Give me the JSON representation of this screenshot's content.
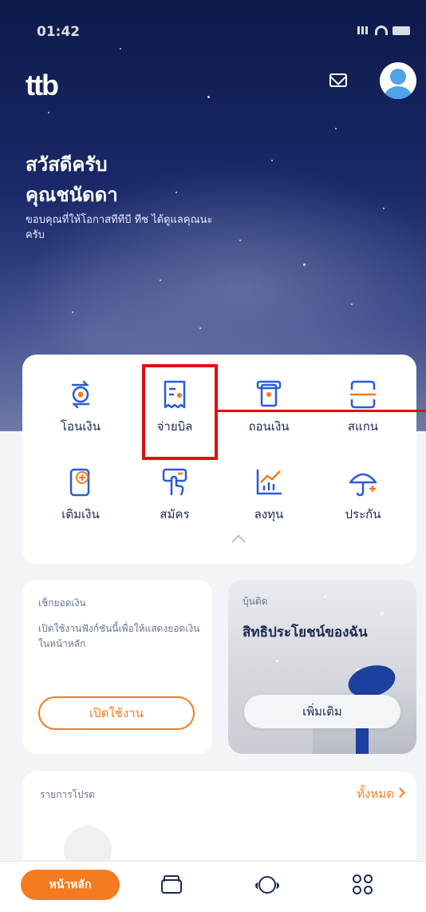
{
  "status_bar": {
    "time": "01:42"
  },
  "header": {
    "logo": "ttb",
    "mail_icon": "mail-icon",
    "avatar_icon": "profile-icon"
  },
  "greeting": {
    "line1": "สวัสดีครับ",
    "line2": "คุณชนัดดา",
    "subtitle": "ขอบคุณที่ให้โอกาสทีทีบี ทีช ได้ดูแลคุณนะครับ"
  },
  "quick_menu": {
    "items": [
      {
        "label": "โอนเงิน",
        "icon": "transfer-icon"
      },
      {
        "label": "จ่ายบิล",
        "icon": "bill-icon"
      },
      {
        "label": "ถอนเงิน",
        "icon": "withdraw-icon"
      },
      {
        "label": "สแกน",
        "icon": "scan-icon"
      },
      {
        "label": "เติมเงิน",
        "icon": "topup-icon"
      },
      {
        "label": "สมัคร",
        "icon": "apply-icon"
      },
      {
        "label": "ลงทุน",
        "icon": "invest-icon"
      },
      {
        "label": "ประกัน",
        "icon": "insurance-icon"
      }
    ]
  },
  "balance_card": {
    "title": "เช็กยอดเงิน",
    "description": "เปิดใช้งานฟังก์ชันนี้เพื่อให้แสดงยอดเงินในหน้าหลัก",
    "button": "เปิดใช้งาน"
  },
  "promo_card": {
    "tag": "บุ้นติด",
    "title": "สิทธิประโยชน์ของฉัน",
    "button": "เพิ่มเติม"
  },
  "favorites": {
    "title": "รายการโปรด",
    "see_all": "ทั้งหมด"
  },
  "bottom_nav": {
    "home": "หน้าหลัก",
    "items": [
      "wallet-icon",
      "support-icon",
      "menu-grid-icon"
    ]
  },
  "colors": {
    "accent": "#f47b20",
    "navy": "#1b2a55",
    "highlight": "#e01010"
  }
}
